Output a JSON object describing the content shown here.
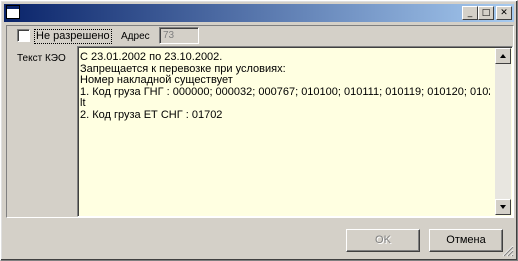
{
  "window": {
    "title": "",
    "minimize_glyph": "_",
    "maximize_glyph": "□",
    "close_glyph": "✕",
    "titlebar_color": "#0a246a"
  },
  "form": {
    "not_allowed_label": "Не разрешено",
    "not_allowed_checked": false,
    "address_label": "Адрес",
    "address_value": "73",
    "kezo_label": "Текст КЭО",
    "memo_background": "#ffffe1",
    "memo_text": "С 23.01.2002 по 23.10.2002.\nЗапрещается к перевозке при условиях:\nНомер накладной существует\n1. Код груза ГНГ : 000000; 000032; 000767; 010100; 010111; 010119; 010120; 0102\nlt\n2. Код груза ЕТ СНГ : 01702"
  },
  "buttons": {
    "ok_label": "OK",
    "ok_enabled": false,
    "cancel_label": "Отмена"
  }
}
